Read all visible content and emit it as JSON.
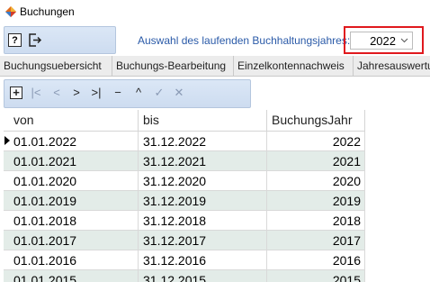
{
  "window": {
    "title": "Buchungen",
    "app_icon": "diamond-app-icon"
  },
  "toolbar": {
    "help_label": "?",
    "help_icon": "help-icon",
    "exit_icon": "exit-icon",
    "year_label": "Auswahl des laufenden Buchhaltungsjahres:",
    "year_value": "2022",
    "year_chevron_icon": "chevron-down-icon",
    "highlight_color": "#e0191e"
  },
  "tabs": [
    {
      "label": "Buchungsuebersicht"
    },
    {
      "label": "Buchungs-Bearbeitung"
    },
    {
      "label": "Einzelkontennachweis"
    },
    {
      "label": "Jahresauswertu"
    }
  ],
  "navigator": {
    "buttons": [
      {
        "name": "add-record-button",
        "label": "+",
        "icon": "plus-icon"
      },
      {
        "name": "first-record-button",
        "label": "|<",
        "icon": "first-icon"
      },
      {
        "name": "prior-record-button",
        "label": "<",
        "icon": "prior-icon"
      },
      {
        "name": "next-record-button",
        "label": ">",
        "icon": "next-icon"
      },
      {
        "name": "last-record-button",
        "label": ">|",
        "icon": "last-icon"
      },
      {
        "name": "delete-record-button",
        "label": "−",
        "icon": "minus-icon"
      },
      {
        "name": "edit-record-button",
        "label": "^",
        "icon": "caret-up-icon"
      },
      {
        "name": "post-record-button",
        "label": "✓",
        "icon": "check-icon"
      },
      {
        "name": "cancel-record-button",
        "label": "✕",
        "icon": "x-icon"
      }
    ]
  },
  "grid": {
    "columns": [
      "von",
      "bis",
      "BuchungsJahr"
    ],
    "rows": [
      [
        "01.01.2022",
        "31.12.2022",
        "2022"
      ],
      [
        "01.01.2021",
        "31.12.2021",
        "2021"
      ],
      [
        "01.01.2020",
        "31.12.2020",
        "2020"
      ],
      [
        "01.01.2019",
        "31.12.2019",
        "2019"
      ],
      [
        "01.01.2018",
        "31.12.2018",
        "2018"
      ],
      [
        "01.01.2017",
        "31.12.2017",
        "2017"
      ],
      [
        "01.01.2016",
        "31.12.2016",
        "2016"
      ],
      [
        "01.01.2015",
        "31.12.2015",
        "2015"
      ]
    ],
    "alt_row_color": "#e3ece8"
  }
}
